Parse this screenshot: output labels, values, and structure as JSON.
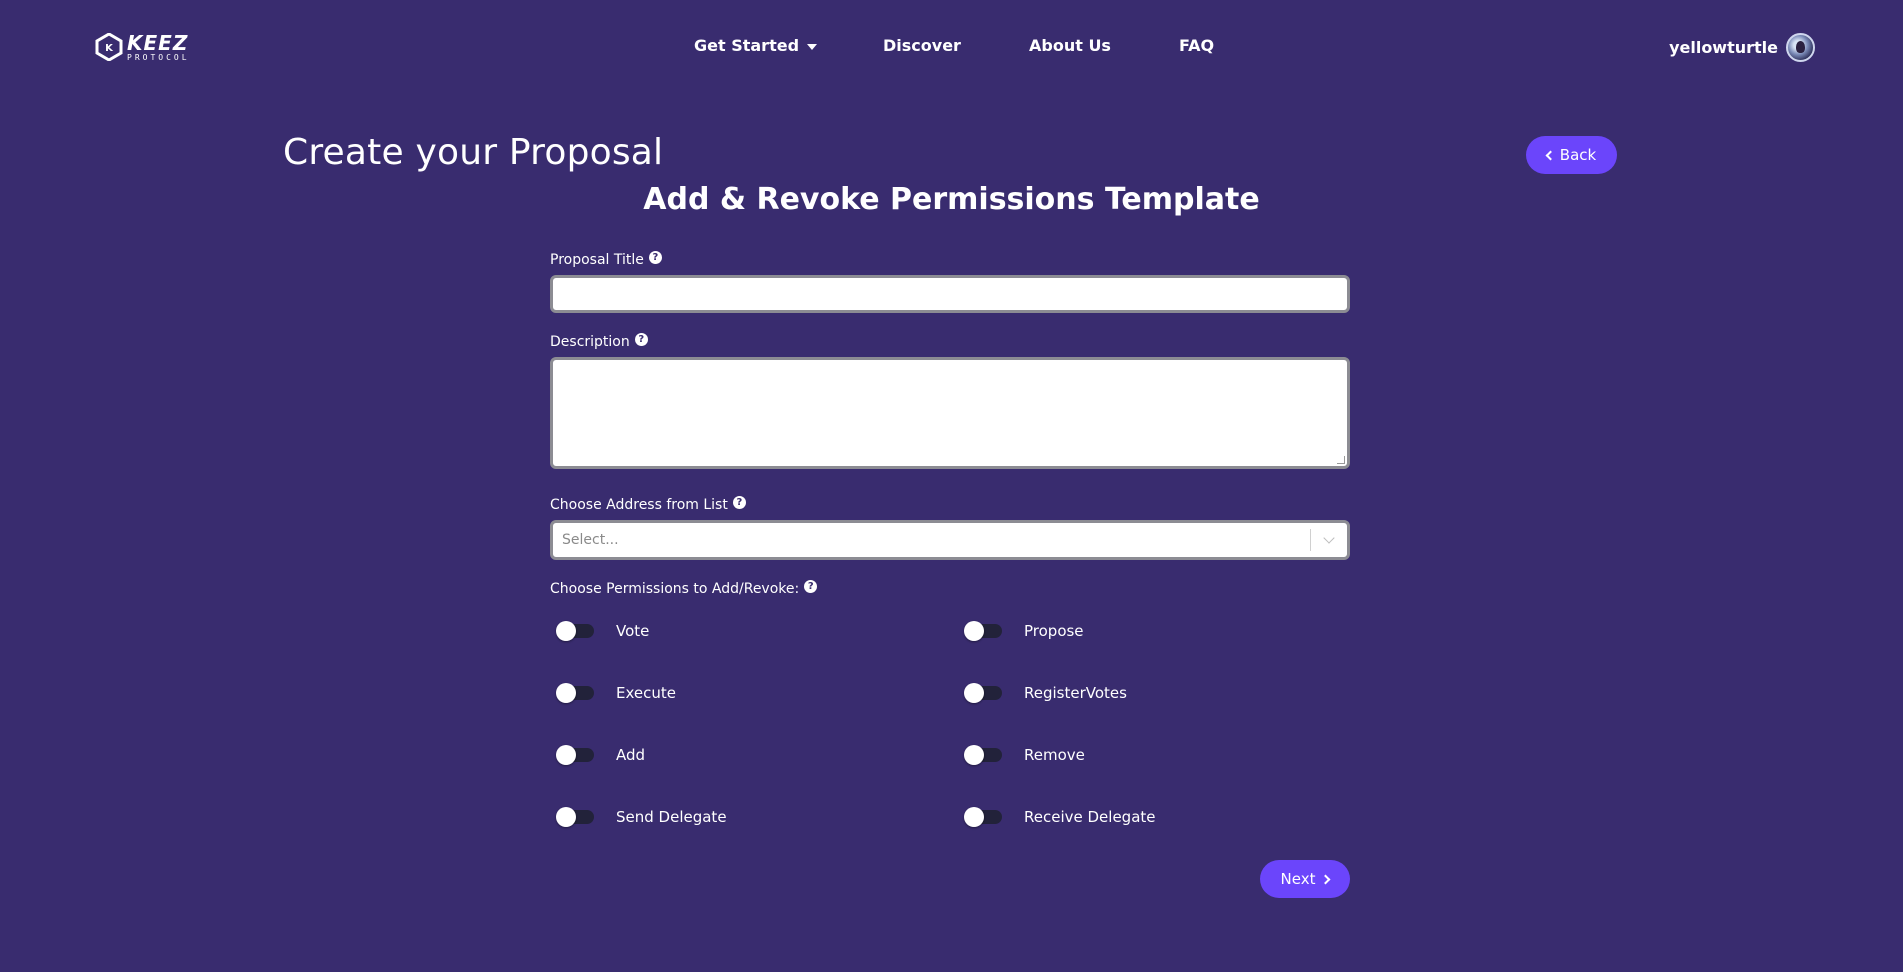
{
  "header": {
    "logo": {
      "big": "KEEZ",
      "small": "PROTOCOL"
    },
    "nav": [
      {
        "label": "Get Started"
      },
      {
        "label": "Discover"
      },
      {
        "label": "About Us"
      },
      {
        "label": "FAQ"
      }
    ],
    "user": {
      "name": "yellowturtle"
    }
  },
  "page": {
    "title": "Create your Proposal",
    "back_label": "Back",
    "template_title": "Add & Revoke Permissions Template"
  },
  "form": {
    "proposal_title": {
      "label": "Proposal Title",
      "value": ""
    },
    "description": {
      "label": "Description",
      "value": ""
    },
    "address": {
      "label": "Choose Address from List",
      "placeholder": "Select..."
    },
    "permissions": {
      "label": "Choose Permissions to Add/Revoke:",
      "items": [
        {
          "label": "Vote",
          "on": false
        },
        {
          "label": "Propose",
          "on": false
        },
        {
          "label": "Execute",
          "on": false
        },
        {
          "label": "RegisterVotes",
          "on": false
        },
        {
          "label": "Add",
          "on": false
        },
        {
          "label": "Remove",
          "on": false
        },
        {
          "label": "Send Delegate",
          "on": false
        },
        {
          "label": "Receive Delegate",
          "on": false
        }
      ]
    },
    "next_label": "Next"
  },
  "colors": {
    "background": "#392c6f",
    "accent": "#6b45fb",
    "toggle_track": "#22223a"
  }
}
